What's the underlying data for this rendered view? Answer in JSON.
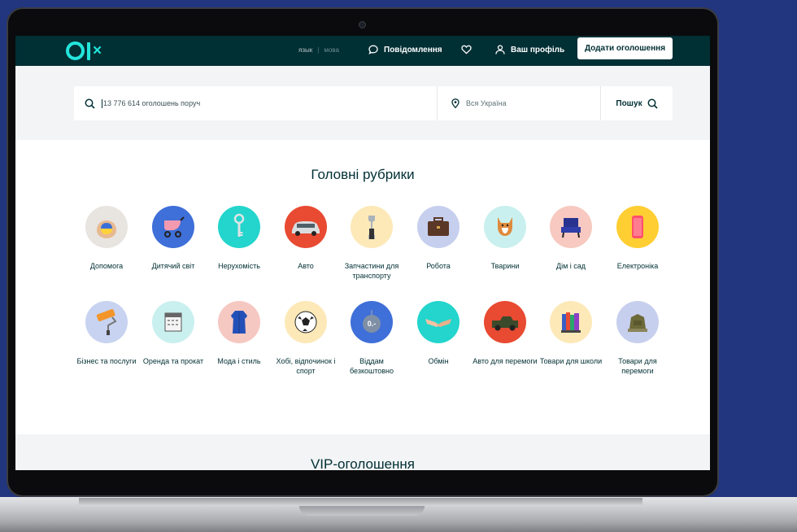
{
  "header": {
    "logo": "olx",
    "lang_active": "язык",
    "lang_inactive": "мова",
    "messages_label": "Повідомлення",
    "profile_label": "Ваш профіль",
    "add_button_label": "Додати оголошення"
  },
  "search": {
    "placeholder": "13 776 614 оголошень поруч",
    "location": "Вся Україна",
    "button_label": "Пошук"
  },
  "categories": {
    "title": "Головні рубрики",
    "row1": [
      {
        "label": "Допомога",
        "color": "#e8e4e0"
      },
      {
        "label": "Дитячий світ",
        "color": "#3f6fd8"
      },
      {
        "label": "Нерухомість",
        "color": "#23d5cc"
      },
      {
        "label": "Авто",
        "color": "#e84a32"
      },
      {
        "label": "Запчастини для транспорту",
        "color": "#fde9b8"
      },
      {
        "label": "Робота",
        "color": "#c7cfee"
      },
      {
        "label": "Тварини",
        "color": "#c9f0ee"
      },
      {
        "label": "Дім і сад",
        "color": "#f7c9c0"
      },
      {
        "label": "Електроніка",
        "color": "#ffce32"
      }
    ],
    "row2": [
      {
        "label": "Бізнес та послуги",
        "color": "#c7d3f0"
      },
      {
        "label": "Оренда та прокат",
        "color": "#c9f0ee"
      },
      {
        "label": "Мода і стиль",
        "color": "#f6c8c2"
      },
      {
        "label": "Хобі, відпочинок і спорт",
        "color": "#fde9b8"
      },
      {
        "label": "Віддам безкоштовно",
        "color": "#3f6fd8"
      },
      {
        "label": "Обмін",
        "color": "#23d5cc"
      },
      {
        "label": "Авто для перемоги",
        "color": "#e84a32"
      },
      {
        "label": "Товари для школи",
        "color": "#fde9b8"
      },
      {
        "label": "Товари для перемоги",
        "color": "#c7cfee"
      }
    ]
  },
  "vip": {
    "title": "VIP-оголошення"
  },
  "colors": {
    "header_bg": "#002f34",
    "accent": "#23e5db",
    "page_bg": "#22357f"
  }
}
